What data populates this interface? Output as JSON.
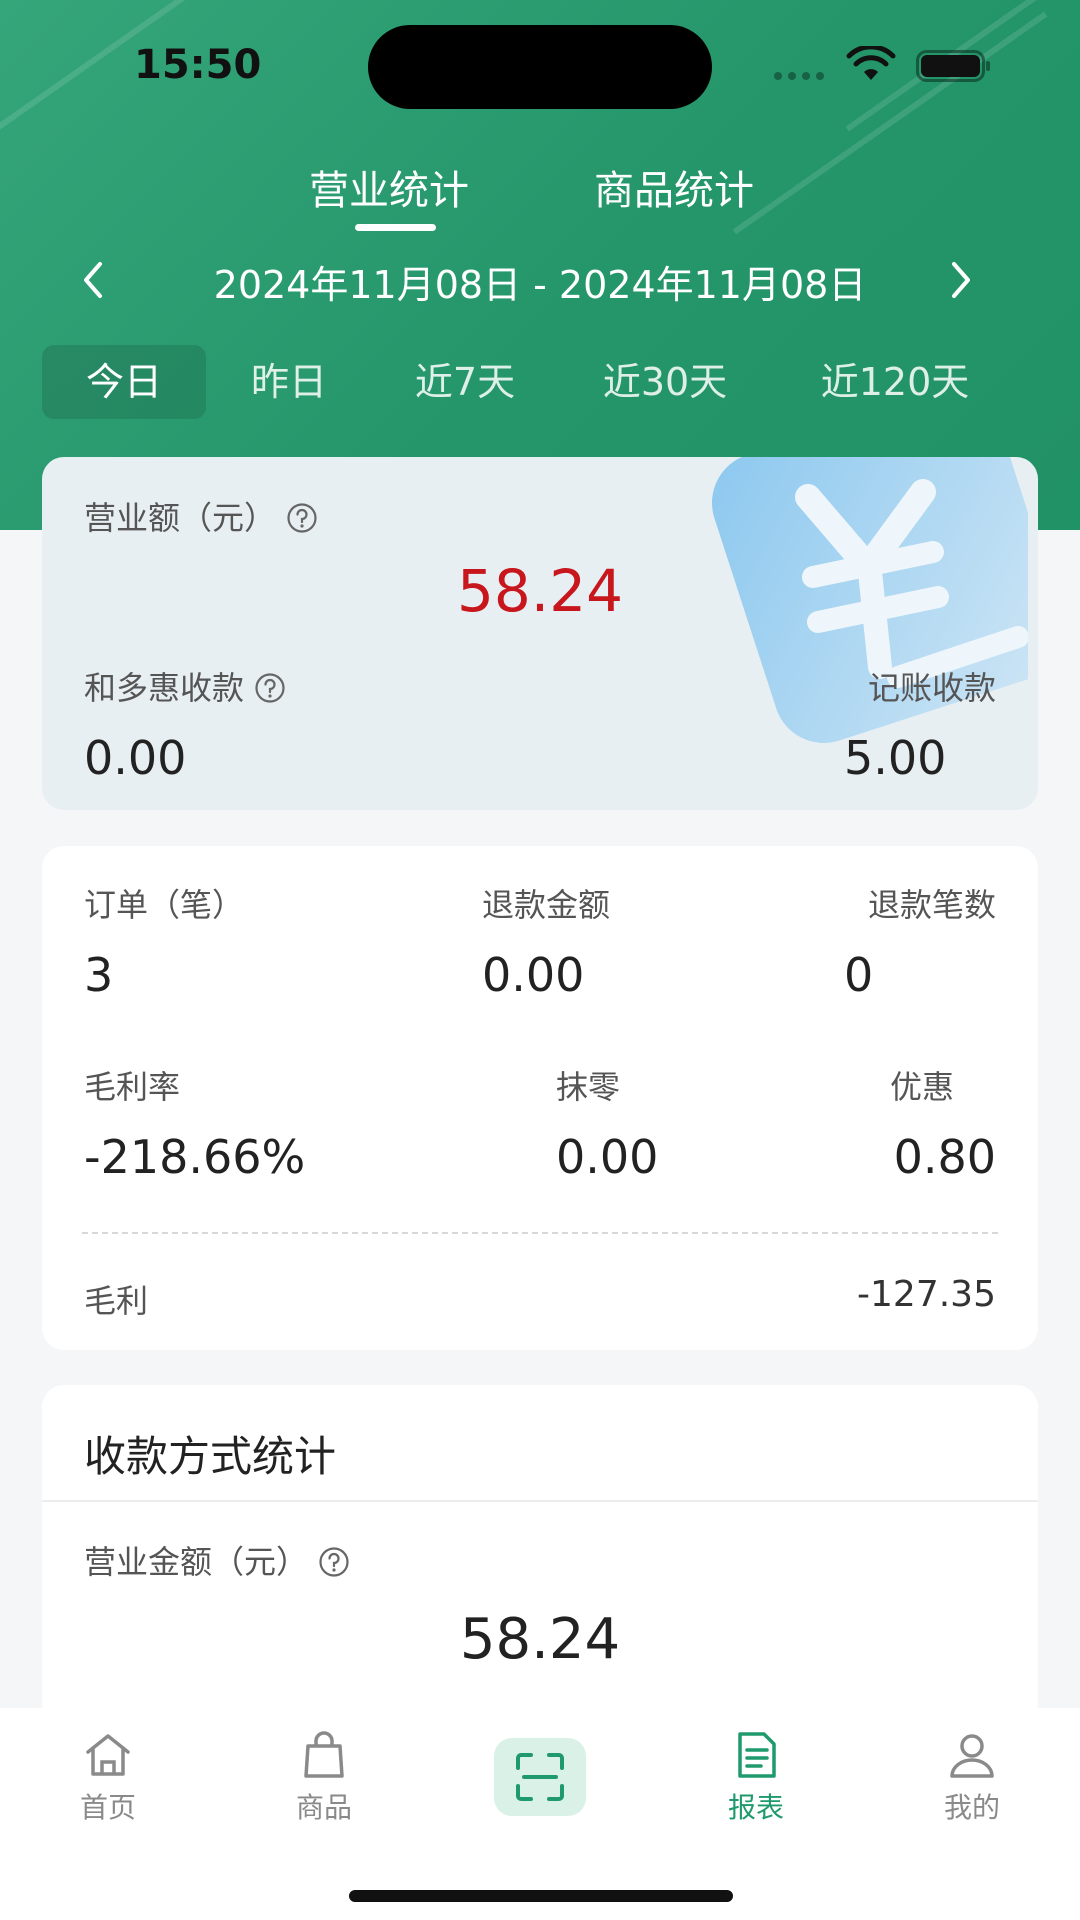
{
  "status_bar": {
    "time": "15:50"
  },
  "top_tabs": [
    {
      "label": "营业统计",
      "active": true
    },
    {
      "label": "商品统计",
      "active": false
    }
  ],
  "date_range": {
    "text": "2024年11月08日 - 2024年11月08日"
  },
  "range_options": [
    {
      "label": "今日",
      "active": true
    },
    {
      "label": "昨日",
      "active": false
    },
    {
      "label": "近7天",
      "active": false
    },
    {
      "label": "近30天",
      "active": false
    },
    {
      "label": "近120天",
      "active": false
    }
  ],
  "revenue_card": {
    "title": "营业额（元）",
    "amount": "58.24",
    "hedohui_label": "和多惠收款",
    "hedohui_value": "0.00",
    "bookkeeping_label": "记账收款",
    "bookkeeping_value": "5.00"
  },
  "orders_card": {
    "orders_label": "订单（笔）",
    "orders_value": "3",
    "refund_amount_label": "退款金额",
    "refund_amount_value": "0.00",
    "refund_count_label": "退款笔数",
    "refund_count_value": "0",
    "gross_margin_label": "毛利率",
    "gross_margin_value": "-218.66%",
    "rounding_label": "抹零",
    "rounding_value": "0.00",
    "discount_label": "优惠",
    "discount_value": "0.80",
    "gross_profit_label": "毛利",
    "gross_profit_value": "-127.35"
  },
  "payment_card": {
    "title": "收款方式统计",
    "amount_label": "营业金额（元）",
    "amount_value": "58.24"
  },
  "bottom_nav": [
    {
      "label": "首页",
      "icon": "home-icon"
    },
    {
      "label": "商品",
      "icon": "bag-icon"
    },
    {
      "label": "",
      "icon": "scan-icon"
    },
    {
      "label": "报表",
      "icon": "report-icon",
      "active": true
    },
    {
      "label": "我的",
      "icon": "user-icon"
    }
  ],
  "colors": {
    "brand_green": "#24966a",
    "accent_red": "#c8161d",
    "active_nav": "#1f9a6d"
  }
}
